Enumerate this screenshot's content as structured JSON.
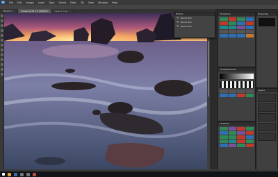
{
  "app": {
    "logo_text": "Ps"
  },
  "menu": [
    "File",
    "Edit",
    "Image",
    "Layer",
    "Type",
    "Select",
    "Filter",
    "3D",
    "View",
    "Window",
    "Help"
  ],
  "tabs": [
    {
      "label": "PEB0870 ...",
      "active": false
    },
    {
      "label": "Sunset @ 66.7% (RGB/16)",
      "active": true
    },
    {
      "label": "Layer 1 copy ...",
      "active": false
    }
  ],
  "history": {
    "title": "History",
    "rows": [
      "Brush Tool",
      "Brush Tool",
      "Brush Tool"
    ]
  },
  "panels": {
    "p1_title": "TK Actions",
    "p2_title": "TK Adjustments",
    "p3_title": "TK Masks",
    "prop_title": "Properties",
    "layers_title": "Layers"
  },
  "colors": {
    "red": "#c0392b",
    "green": "#2e8b57",
    "blue": "#2f6fb3",
    "purple": "#7b4fa0",
    "teal": "#1f8a8a",
    "orange": "#c9772e"
  },
  "taskbar": {
    "clock": ""
  }
}
